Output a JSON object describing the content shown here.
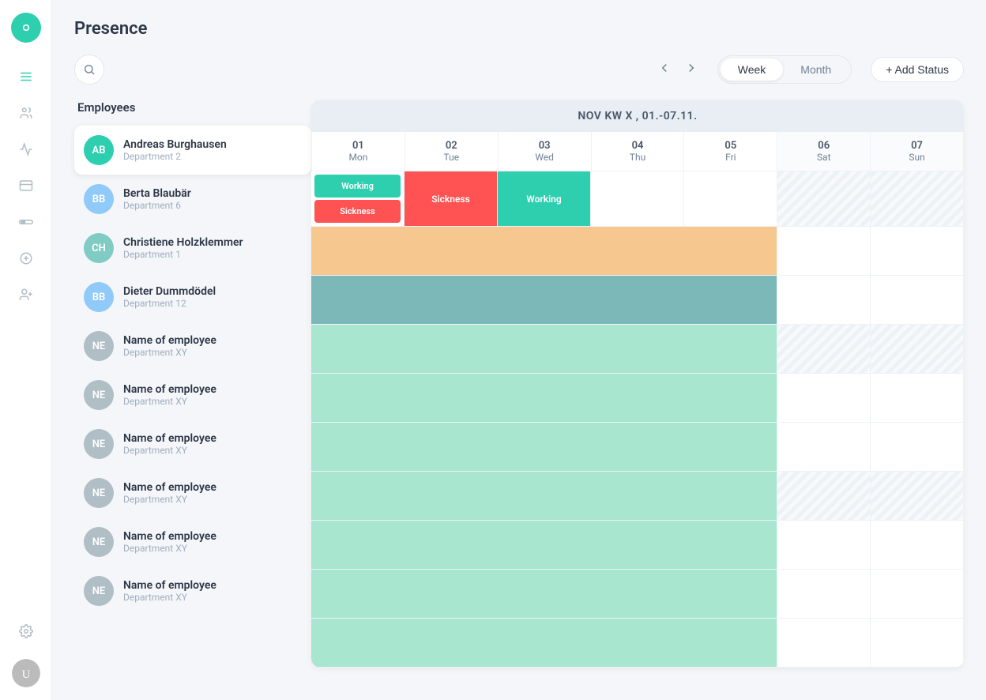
{
  "app": {
    "logo_initial": "O"
  },
  "sidebar": {
    "icons": [
      {
        "name": "menu-icon",
        "symbol": "☰"
      },
      {
        "name": "people-icon",
        "symbol": "👥"
      },
      {
        "name": "chart-icon",
        "symbol": "📈"
      },
      {
        "name": "card-icon",
        "symbol": "▤"
      },
      {
        "name": "toggle-icon",
        "symbol": "⊙"
      },
      {
        "name": "coin-icon",
        "symbol": "⊕"
      },
      {
        "name": "user-plus-icon",
        "symbol": "👤+"
      },
      {
        "name": "settings-icon",
        "symbol": "⚙"
      }
    ]
  },
  "header": {
    "title": "Presence",
    "week_label": "Week",
    "month_label": "Month",
    "add_status_label": "+ Add Status"
  },
  "calendar": {
    "period_label": "NOV   KW X , 01.-07.11.",
    "days": [
      {
        "num": "01",
        "name": "Mon",
        "weekend": false
      },
      {
        "num": "02",
        "name": "Tue",
        "weekend": false
      },
      {
        "num": "03",
        "name": "Wed",
        "weekend": false
      },
      {
        "num": "04",
        "name": "Thu",
        "weekend": false
      },
      {
        "num": "05",
        "name": "Fri",
        "weekend": false
      },
      {
        "num": "06",
        "name": "Sat",
        "weekend": true
      },
      {
        "num": "07",
        "name": "Sun",
        "weekend": true
      }
    ]
  },
  "employees_title": "Employees",
  "employees": [
    {
      "initials": "AB",
      "name": "Andreas Burghausen",
      "dept": "Department 2",
      "av_class": "av-ab",
      "selected": true
    },
    {
      "initials": "BB",
      "name": "Berta Blaubär",
      "dept": "Department 6",
      "av_class": "av-bb",
      "selected": false
    },
    {
      "initials": "CH",
      "name": "Christiene Holzklemmer",
      "dept": "Department 1",
      "av_class": "av-ch",
      "selected": false
    },
    {
      "initials": "BB",
      "name": "Dieter Dummdödel",
      "dept": "Department 12",
      "av_class": "av-dd",
      "selected": false
    },
    {
      "initials": "NE",
      "name": "Name of employee",
      "dept": "Department XY",
      "av_class": "av-ne",
      "selected": false
    },
    {
      "initials": "NE",
      "name": "Name of employee",
      "dept": "Department XY",
      "av_class": "av-ne",
      "selected": false
    },
    {
      "initials": "NE",
      "name": "Name of employee",
      "dept": "Department XY",
      "av_class": "av-ne",
      "selected": false
    },
    {
      "initials": "NE",
      "name": "Name of employee",
      "dept": "Department XY",
      "av_class": "av-ne",
      "selected": false
    },
    {
      "initials": "NE",
      "name": "Name of employee",
      "dept": "Department XY",
      "av_class": "av-ne",
      "selected": false
    },
    {
      "initials": "NE",
      "name": "Name of employee",
      "dept": "Department XY",
      "av_class": "av-ne",
      "selected": false
    }
  ],
  "status_labels": {
    "working": "Working",
    "sickness": "Sickness"
  },
  "rows": [
    {
      "type": "ab",
      "cells": [
        {
          "col": 1,
          "type": "working+sickness"
        },
        {
          "col": 2,
          "type": "sickness-full"
        },
        {
          "col": 3,
          "type": "working-full"
        },
        {
          "col": 4,
          "type": "empty"
        },
        {
          "col": 5,
          "type": "empty"
        },
        {
          "col": 6,
          "type": "weekend"
        },
        {
          "col": 7,
          "type": "weekend"
        }
      ]
    },
    {
      "type": "orange",
      "cells": [
        {
          "col": "1-5",
          "type": "orange-span"
        },
        {
          "col": 6,
          "type": "empty"
        },
        {
          "col": 7,
          "type": "empty"
        }
      ]
    },
    {
      "type": "teal",
      "cells": [
        {
          "col": "1-5",
          "type": "teal-span"
        },
        {
          "col": 6,
          "type": "empty"
        },
        {
          "col": 7,
          "type": "empty"
        }
      ]
    },
    {
      "type": "mint",
      "cells": [
        {
          "col": "1-5",
          "type": "mint-span"
        },
        {
          "col": 6,
          "type": "empty"
        },
        {
          "col": 7,
          "type": "weekend"
        }
      ]
    }
  ]
}
